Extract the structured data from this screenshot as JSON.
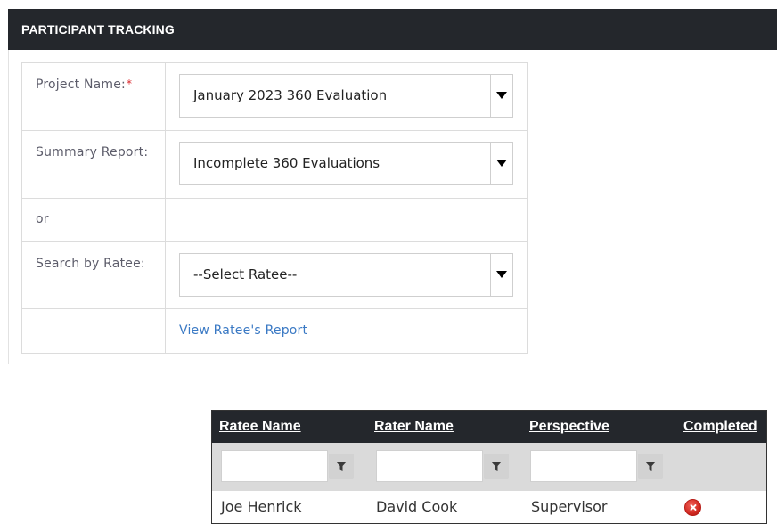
{
  "header": {
    "title": "PARTICIPANT TRACKING"
  },
  "form": {
    "project_label": "Project Name:",
    "required_mark": "*",
    "project_value": "January 2023 360 Evaluation",
    "summary_label": "Summary Report:",
    "summary_value": "Incomplete 360 Evaluations",
    "or_label": "or",
    "ratee_label": "Search by Ratee:",
    "ratee_value": "--Select Ratee--",
    "view_report_link": "View Ratee's Report"
  },
  "grid": {
    "columns": [
      "Ratee Name",
      "Rater Name",
      "Perspective",
      "Completed"
    ],
    "filters": [
      {
        "value": "",
        "icon": "filter-icon"
      },
      {
        "value": "",
        "icon": "filter-icon"
      },
      {
        "value": "",
        "icon": "filter-icon"
      }
    ],
    "rows": [
      {
        "ratee": "Joe Henrick",
        "rater": "David Cook",
        "perspective": "Supervisor",
        "completed": "not-completed-icon"
      }
    ]
  },
  "colors": {
    "header_bg": "#24272c",
    "link": "#3a79c4",
    "required": "#d9262b",
    "status_incomplete": "#d22a22"
  }
}
